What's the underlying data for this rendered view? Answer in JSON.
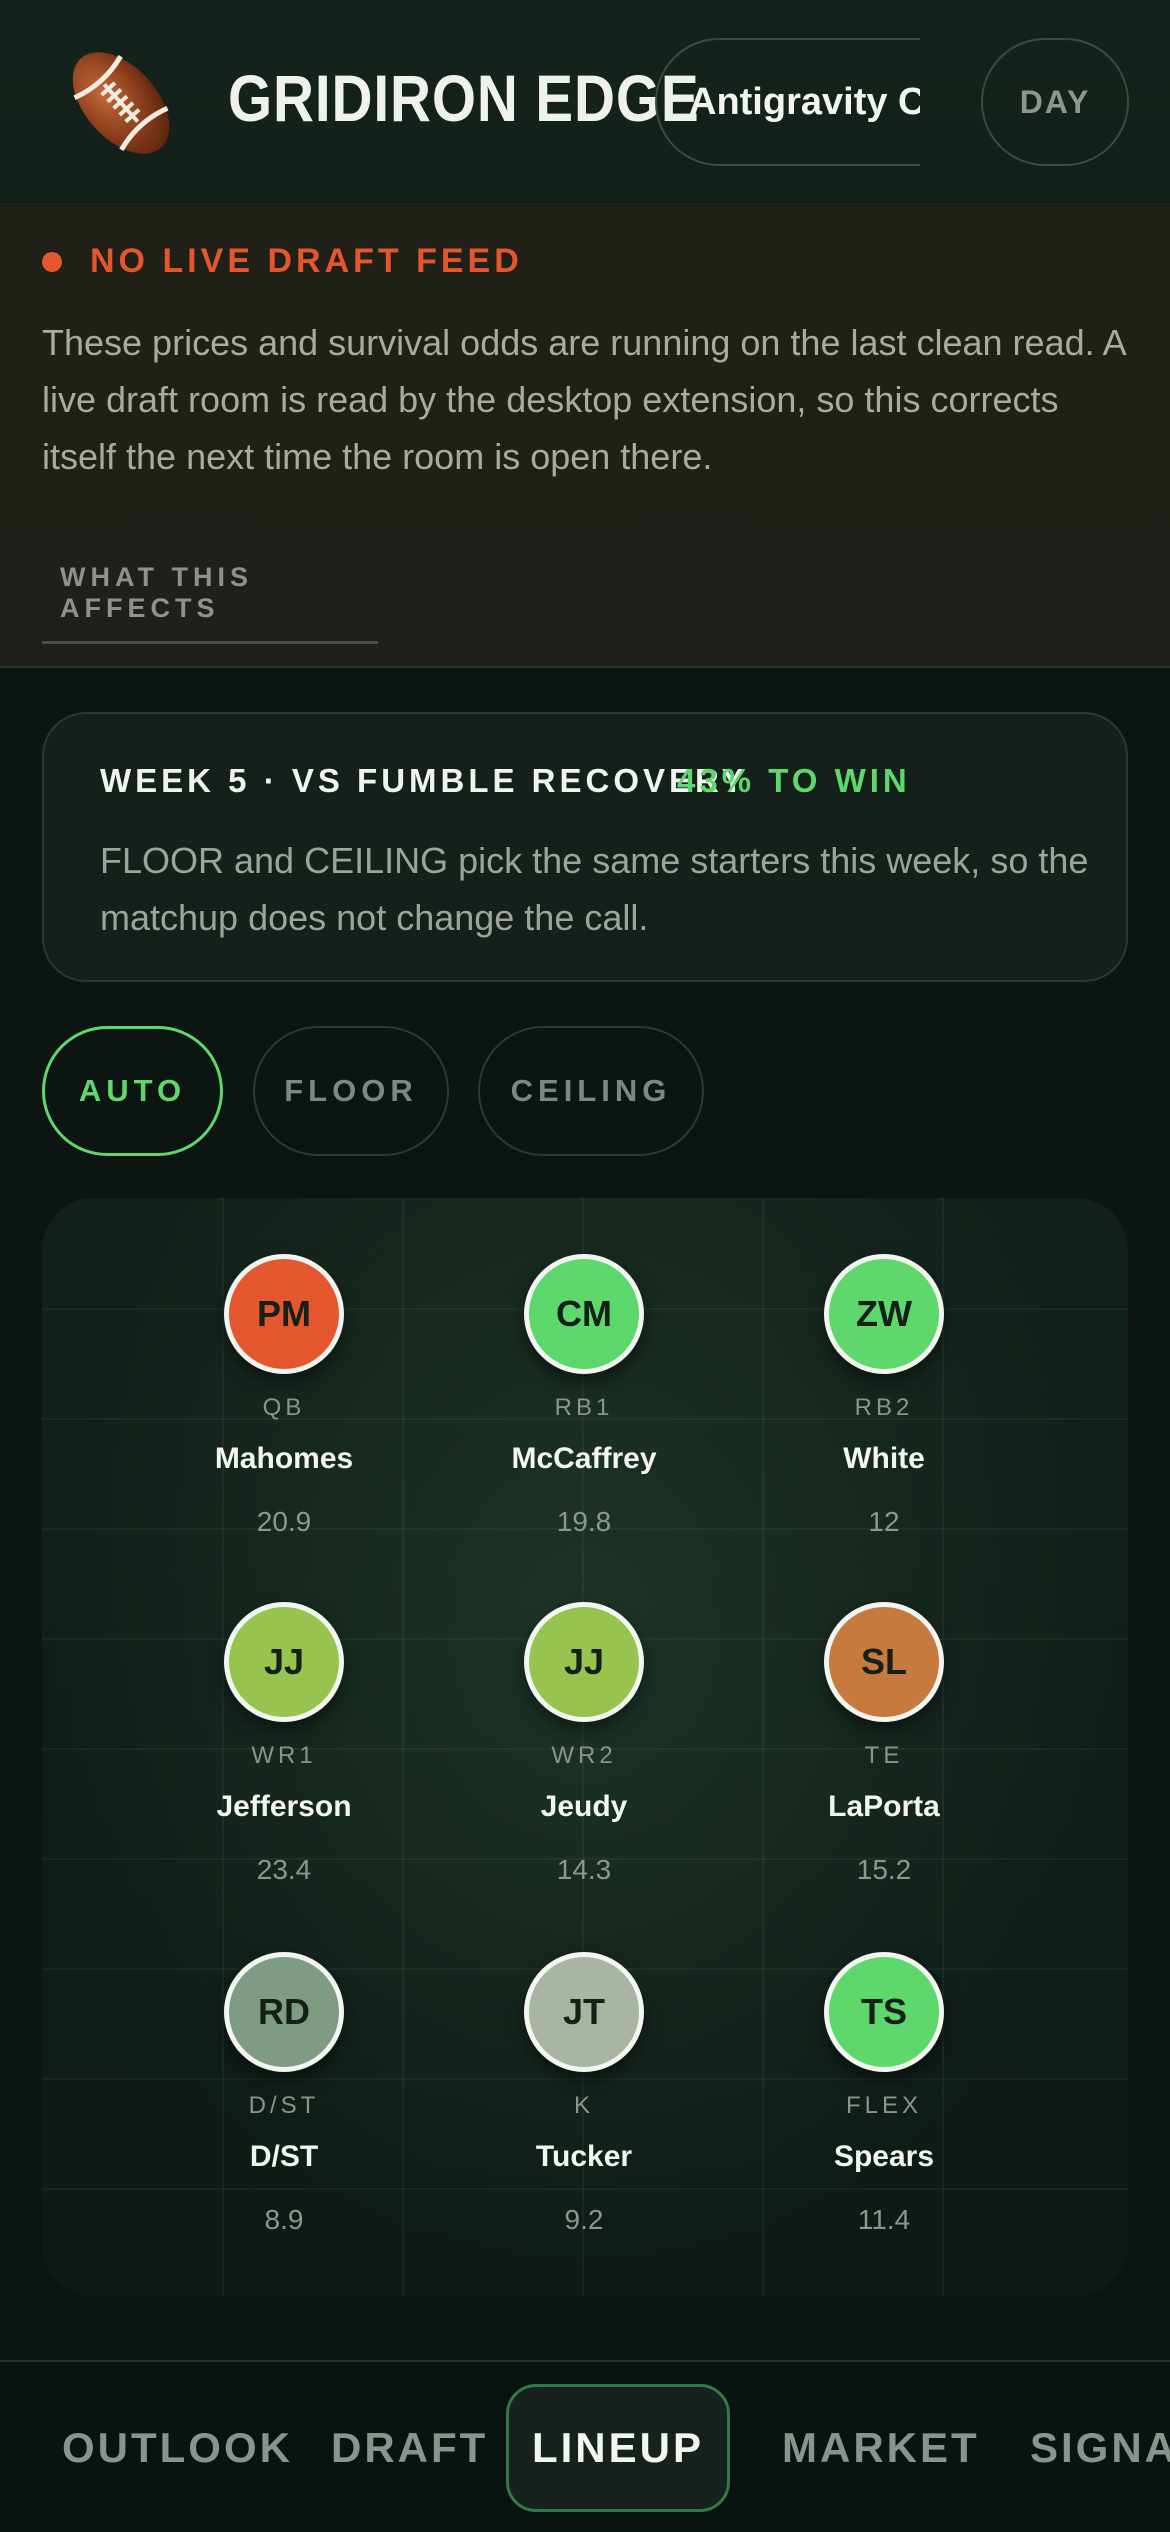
{
  "header": {
    "app_title": "GRIDIRON EDGE",
    "team_name": "Antigravity Cha",
    "mode_label": "DAY",
    "logo_icon": "football-icon"
  },
  "alert": {
    "title": "NO LIVE DRAFT FEED",
    "body": "These prices and survival odds are running on the last clean read. A live draft room is read by the desktop extension, so this corrects itself the next time the room is open there.",
    "affects_label": "WHAT THIS AFFECTS",
    "dot_color": "#e4572e"
  },
  "matchup": {
    "title": "WEEK 5 · VS FUMBLE RECOVERY",
    "odds": "43% TO WIN",
    "body": "FLOOR and CEILING pick the same starters this week, so the matchup does not change the call."
  },
  "modes": {
    "auto": "AUTO",
    "floor": "FLOOR",
    "ceiling": "CEILING",
    "active": "AUTO"
  },
  "lineup": [
    {
      "initials": "PM",
      "pos": "QB",
      "name": "Mahomes",
      "pts": "20.9",
      "color": "#e4572e"
    },
    {
      "initials": "CM",
      "pos": "RB1",
      "name": "McCaffrey",
      "pts": "19.8",
      "color": "#5ed86c"
    },
    {
      "initials": "ZW",
      "pos": "RB2",
      "name": "White",
      "pts": "12",
      "color": "#5ed86c"
    },
    {
      "initials": "JJ",
      "pos": "WR1",
      "name": "Jefferson",
      "pts": "23.4",
      "color": "#97c44f"
    },
    {
      "initials": "JJ",
      "pos": "WR2",
      "name": "Jeudy",
      "pts": "14.3",
      "color": "#97c44f"
    },
    {
      "initials": "SL",
      "pos": "TE",
      "name": "LaPorta",
      "pts": "15.2",
      "color": "#c77a3d"
    },
    {
      "initials": "RD",
      "pos": "D/ST",
      "name": "D/ST",
      "pts": "8.9",
      "color": "#7e9c84"
    },
    {
      "initials": "JT",
      "pos": "K",
      "name": "Tucker",
      "pts": "9.2",
      "color": "#a9b5a2"
    },
    {
      "initials": "TS",
      "pos": "FLEX",
      "name": "Spears",
      "pts": "11.4",
      "color": "#5ed86c"
    }
  ],
  "nav": {
    "outlook": "OUTLOOK",
    "draft": "DRAFT",
    "lineup": "LINEUP",
    "market": "MARKET",
    "signals": "SIGNAL",
    "active": "LINEUP"
  }
}
